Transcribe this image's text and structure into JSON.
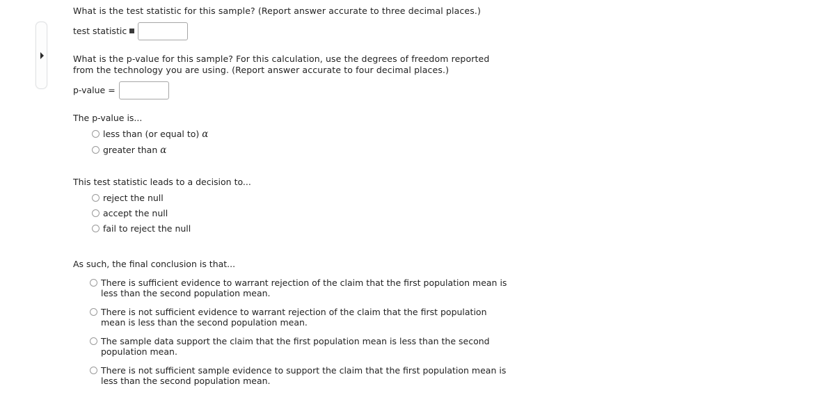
{
  "sidebar": {
    "toggle_label": "Expand sidebar",
    "icon": "triangle-right-icon"
  },
  "questions": {
    "test_statistic": {
      "prompt": "What is the test statistic for this sample? (Report answer accurate to three decimal places.)",
      "field_label": "test statistic",
      "equals": "=",
      "value": "",
      "placeholder": ""
    },
    "p_value": {
      "prompt": "What is the p-value for this sample? For this calculation, use the degrees of freedom reported from the technology you are using. (Report answer accurate to four decimal places.)",
      "field_label": "p-value",
      "equals": "=",
      "value": "",
      "placeholder": ""
    }
  },
  "pvalue_compare": {
    "prompt": "The p-value is...",
    "options": [
      {
        "text": "less than (or equal to) ",
        "symbol": "α"
      },
      {
        "text": "greater than ",
        "symbol": "α"
      }
    ]
  },
  "decision": {
    "prompt": "This test statistic leads to a decision to...",
    "options": [
      {
        "text": "reject the null"
      },
      {
        "text": "accept the null"
      },
      {
        "text": "fail to reject the null"
      }
    ]
  },
  "conclusion": {
    "prompt": "As such, the final conclusion is that...",
    "options": [
      {
        "text": "There is sufficient evidence to warrant rejection of the claim that the first population mean is less than the second population mean."
      },
      {
        "text": "There is not sufficient evidence to warrant rejection of the claim that the first population mean is less than the second population mean."
      },
      {
        "text": "The sample data support the claim that the first population mean is less than the second population mean."
      },
      {
        "text": "There is not sufficient sample evidence to support the claim that the first population mean is less than the second population mean."
      }
    ]
  },
  "colors": {
    "background": "#ffffff",
    "text": "#222222",
    "input_border": "#a6a6a6",
    "radio_border": "#9a9a9a",
    "handle_border": "#e0e2e4"
  }
}
